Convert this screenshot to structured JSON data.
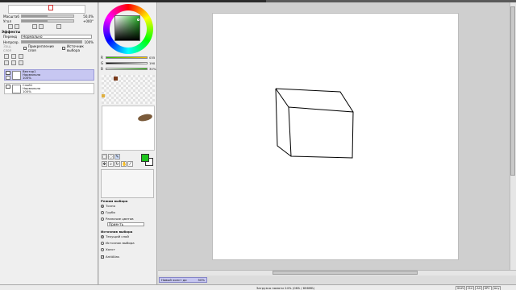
{
  "nav": {
    "opacity_label": "Масштаб",
    "opacity_value": "50,0%",
    "angle_label": "Угол",
    "angle_value": "+000°"
  },
  "effects": {
    "section_label": "Эффекты",
    "mode_label": "Перемд",
    "mode_value": "Нормально",
    "opacity_label": "Непрозр.",
    "opacity_value": "100%",
    "protect_label": "Защ. слоя",
    "clip_label": "Прикрепление слоя",
    "source_label": "Источник выбора"
  },
  "layers": [
    {
      "name": "Вектор1",
      "mode": "Нормально",
      "opacity": "100%",
      "selected": true
    },
    {
      "name": "Слой1",
      "mode": "Нормально",
      "opacity": "100%",
      "selected": false
    }
  ],
  "color": {
    "fg": "#1cc41c",
    "bg": "#ffffff",
    "channels": [
      {
        "ch": "R",
        "value": "035"
      },
      {
        "ch": "G",
        "value": "190"
      },
      {
        "ch": "B",
        "value": "30%"
      }
    ]
  },
  "brush_grid": [
    {
      "name": "Pen",
      "row": 0,
      "col": 0
    },
    {
      "name": "Eraser",
      "row": 0,
      "col": 1
    },
    {
      "name": "Weight",
      "row": 0,
      "col": 2
    },
    {
      "name": "Color",
      "row": 0,
      "col": 3
    },
    {
      "name": "Edit",
      "row": 1,
      "col": 0
    },
    {
      "name": "Pressure",
      "row": 1,
      "col": 1
    },
    {
      "name": "Select",
      "row": 1,
      "col": 2
    },
    {
      "name": "Deselect",
      "row": 1,
      "col": 3
    },
    {
      "name": "Curve",
      "row": 2,
      "col": 0
    },
    {
      "name": "Line",
      "row": 2,
      "col": 1
    }
  ],
  "options": {
    "mode_title": "Режим выбора",
    "radio_fine": "Точно",
    "radio_rough": "Грубо",
    "radio_diff": "Различие цветов",
    "dropdown": "Прим-ть",
    "source_title": "Источник выбора",
    "radio_current": "Текущий слой",
    "radio_source": "Источник выбора",
    "radio_canvas": "Холст",
    "antialias": "AntiAlias"
  },
  "status": {
    "tab_name": "Новый холст до",
    "tab_zoom": "50%",
    "memory": "Загрузка памяти 24% (0КБ / 696МБ)",
    "keys": [
      "Shift",
      "Ctrl",
      "Alt",
      "SPC",
      "Any"
    ]
  }
}
